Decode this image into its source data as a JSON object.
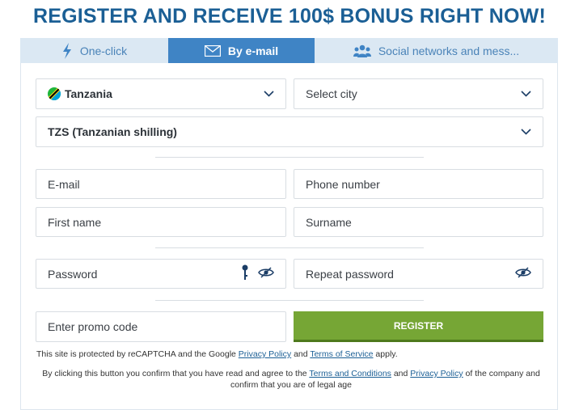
{
  "heading": "REGISTER AND RECEIVE 100$ BONUS RIGHT NOW!",
  "tabs": [
    {
      "label": "One-click",
      "icon": "lightning-icon"
    },
    {
      "label": "By e-mail",
      "icon": "envelope-icon",
      "active": true
    },
    {
      "label": "Social networks and mess...",
      "icon": "people-icon"
    }
  ],
  "form": {
    "country": "Tanzania",
    "city_placeholder": "Select city",
    "currency": "TZS (Tanzanian shilling)",
    "email_placeholder": "E-mail",
    "phone_placeholder": "Phone number",
    "first_name_placeholder": "First name",
    "surname_placeholder": "Surname",
    "password_placeholder": "Password",
    "repeat_password_placeholder": "Repeat password",
    "promo_placeholder": "Enter promo code",
    "register_label": "REGISTER"
  },
  "notes": {
    "recaptcha_prefix": "This site is protected by reCAPTCHA and the Google ",
    "privacy_policy": "Privacy Policy",
    "and": " and ",
    "terms_of_service": "Terms of Service",
    "recaptcha_suffix": " apply.",
    "confirm_prefix": "By clicking this button you confirm that you have read and agree to the ",
    "terms_and_conditions": "Terms and Conditions",
    "confirm_and": " and ",
    "privacy_policy_2": "Privacy Policy",
    "confirm_suffix": " of the company and confirm that you are of legal age"
  },
  "colors": {
    "heading": "#1b5f95",
    "tab_active": "#3f84c5",
    "tab_inactive": "#dbe8f3",
    "register": "#76a635"
  }
}
